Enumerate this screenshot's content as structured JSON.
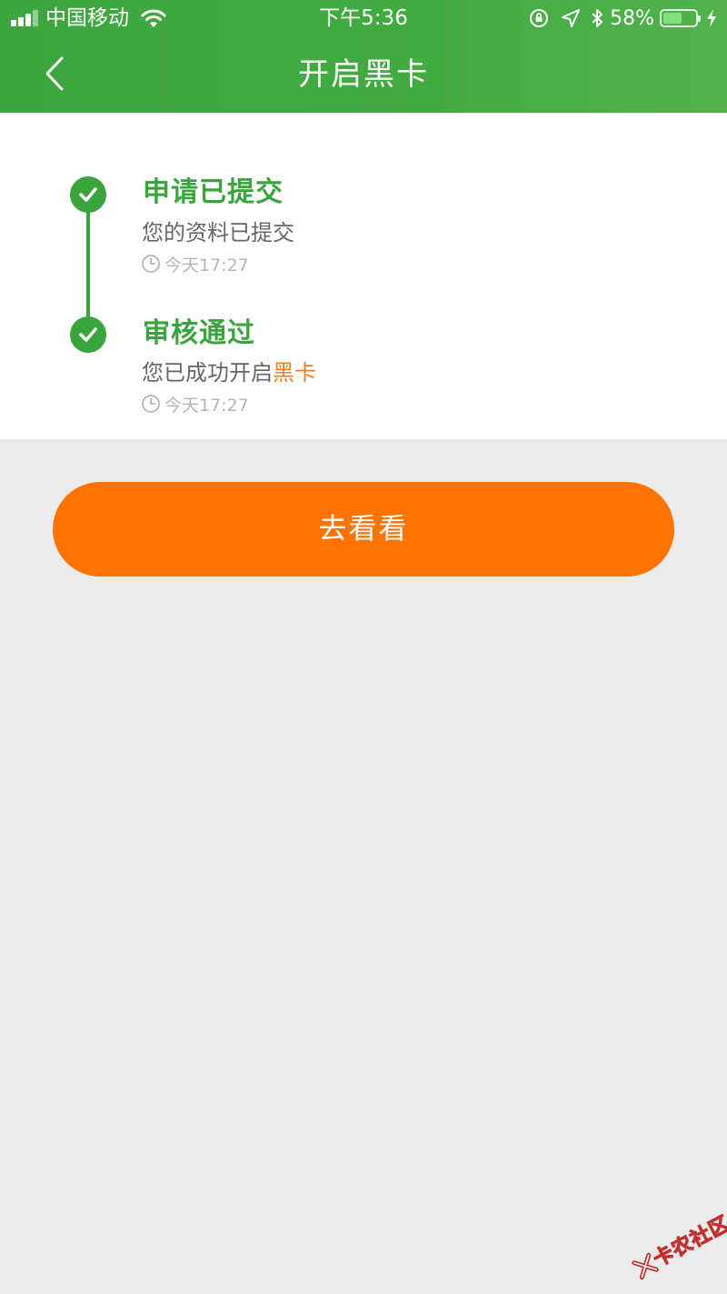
{
  "status_bar": {
    "carrier": "中国移动",
    "time": "下午5:36",
    "battery_percent": "58%",
    "battery_level": 0.58
  },
  "nav": {
    "title": "开启黑卡"
  },
  "steps": [
    {
      "title": "申请已提交",
      "description": "您的资料已提交",
      "time": "今天17:27"
    },
    {
      "title": "审核通过",
      "description_prefix": "您已成功开启",
      "description_highlight": "黑卡",
      "time": "今天17:27"
    }
  ],
  "action_button": {
    "label": "去看看"
  },
  "watermark": {
    "text": "卡农社区"
  },
  "colors": {
    "brand_green": "#3aa53d",
    "accent_orange": "#ff7300",
    "page_background": "#ebebeb"
  }
}
